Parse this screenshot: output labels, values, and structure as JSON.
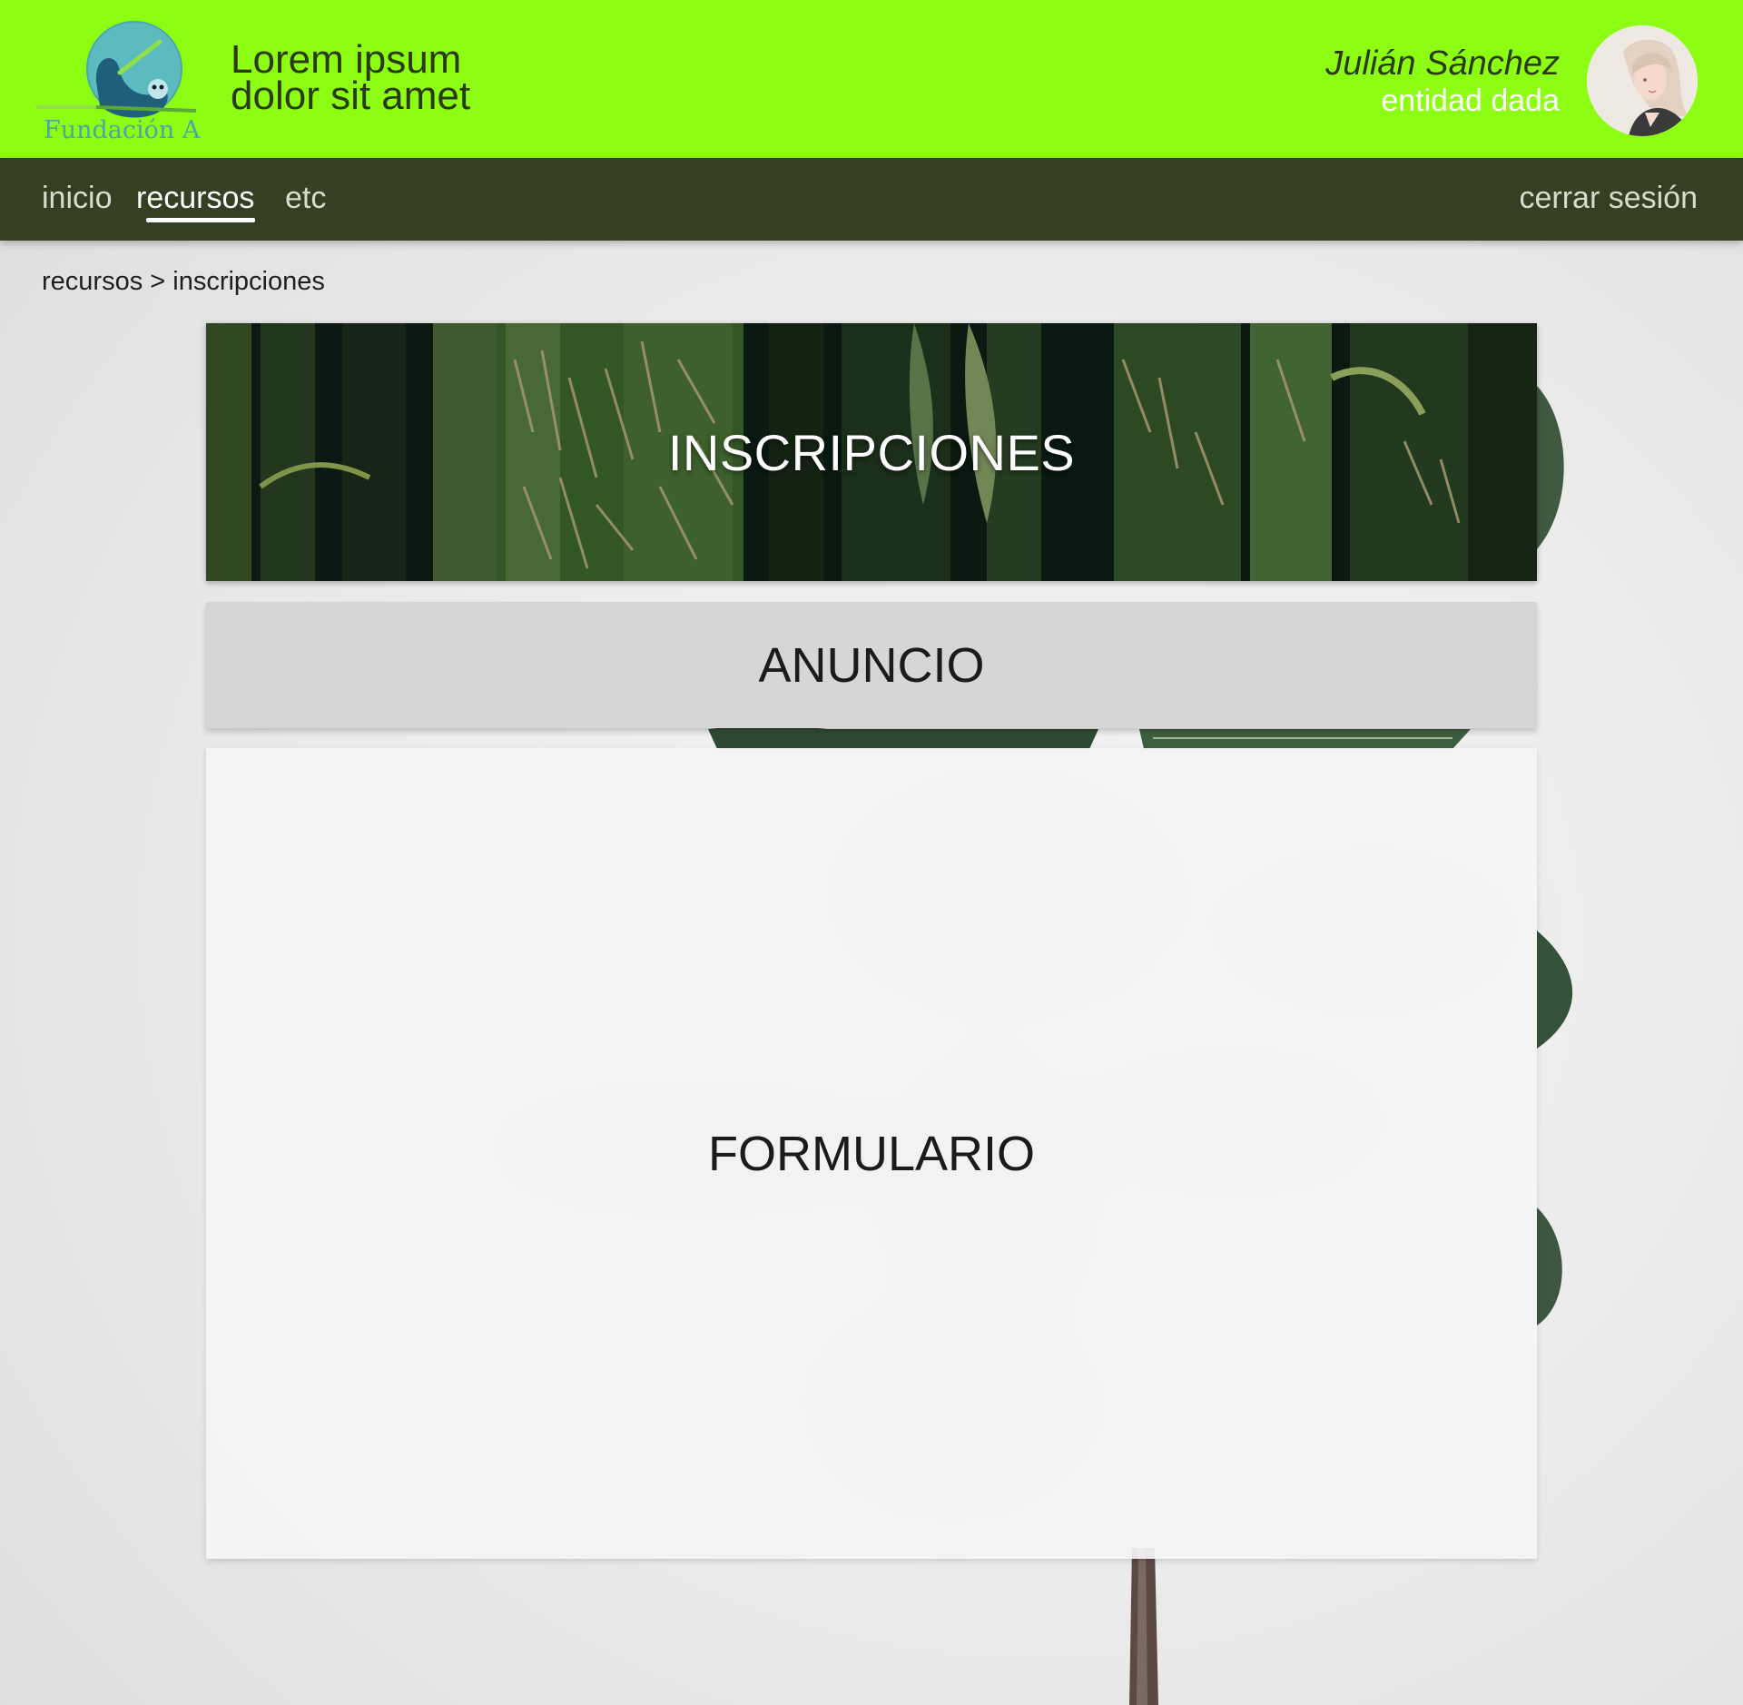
{
  "header": {
    "logo_text": "Fundación A",
    "title_line1": "Lorem ipsum",
    "title_line2": "dolor sit amet",
    "user_name": "Julián Sánchez",
    "user_entity": "entidad dada"
  },
  "nav": {
    "items": [
      {
        "label": "inicio",
        "active": false
      },
      {
        "label": "recursos",
        "active": true
      },
      {
        "label": "etc",
        "active": false
      }
    ],
    "logout_label": "cerrar sesión"
  },
  "breadcrumb": "recursos > inscripciones",
  "main": {
    "banner_title": "INSCRIPCIONES",
    "announce_label": "ANUNCIO",
    "form_label": "FORMULARIO"
  },
  "colors": {
    "header_bg": "#8dfd13",
    "navbar_bg": "#353f22",
    "announce_bg": "#d6d6d6",
    "form_bg": "#f4f4f4"
  }
}
